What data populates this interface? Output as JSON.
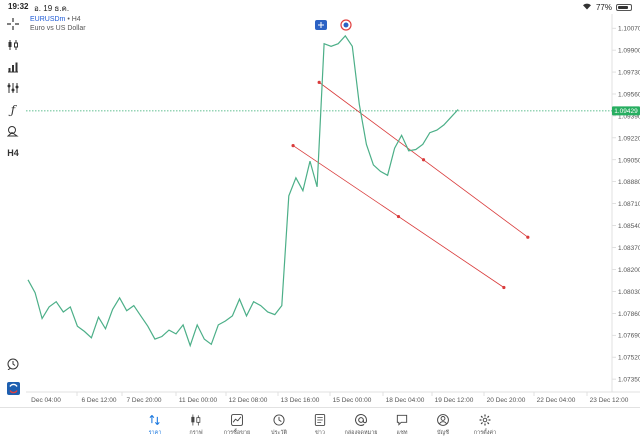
{
  "status_bar": {
    "time": "19:32",
    "date": "อ. 19 ธ.ค.",
    "battery": "77%",
    "battery_level": 0.77
  },
  "symbol": {
    "name": "EURUSDm",
    "timeframe": "H4",
    "description": "Euro vs US Dollar"
  },
  "toolbar_icons": [
    "crosshair-icon",
    "candlestick-icon",
    "chart-type-icon",
    "indicators-icon",
    "function-icon",
    "objects-icon",
    "timeframe-icon",
    "clock-icon",
    "logo-icon"
  ],
  "toolbar": {
    "timeframe_label": "H4"
  },
  "colors": {
    "line": "#4caf88",
    "bid_line": "#2eaa6e",
    "price_badge": "#27ae60",
    "trendline": "#d93b3b",
    "accent": "#1e7ae0"
  },
  "chart_data": {
    "type": "line",
    "symbol": "EURUSDm",
    "current_price": "1.09429",
    "ylim": [
      1.0725,
      1.1018
    ],
    "y_ticks": [
      "1.10070",
      "1.09900",
      "1.09730",
      "1.09560",
      "1.09390",
      "1.09220",
      "1.09050",
      "1.08880",
      "1.08710",
      "1.08540",
      "1.08370",
      "1.08200",
      "1.08030",
      "1.07860",
      "1.07690",
      "1.07520",
      "1.07350"
    ],
    "x_ticks": [
      "Dec 04:00",
      "6 Dec 12:00",
      "7 Dec 20:00",
      "11 Dec 00:00",
      "12 Dec 08:00",
      "13 Dec 16:00",
      "15 Dec 00:00",
      "18 Dec 04:00",
      "19 Dec 12:00",
      "20 Dec 20:00",
      "22 Dec 04:00",
      "23 Dec 12:00"
    ],
    "series": [
      {
        "values": [
          1.0812,
          1.0802,
          1.0782,
          1.0791,
          1.0795,
          1.0787,
          1.0791,
          1.0776,
          1.0772,
          1.0767,
          1.0783,
          1.0774,
          1.0789,
          1.0798,
          1.0788,
          1.0792,
          1.0784,
          1.0776,
          1.0766,
          1.0768,
          1.0773,
          1.077,
          1.0777,
          1.0761,
          1.0777,
          1.0766,
          1.0762,
          1.0777,
          1.078,
          1.0784,
          1.0797,
          1.0784,
          1.0795,
          1.0792,
          1.0787,
          1.0785,
          1.0792,
          1.0877,
          1.0891,
          1.0881,
          1.0904,
          1.0884,
          1.0995,
          1.0993,
          1.0995,
          1.1001,
          1.0993,
          1.0948,
          1.0917,
          1.0901,
          1.0896,
          1.0893,
          1.0914,
          1.0924,
          1.0912,
          1.0913,
          1.0917,
          1.0926,
          1.0928,
          1.0932,
          1.0938,
          1.0944
        ]
      }
    ],
    "trendlines": [
      {
        "x1": 41.3,
        "y1": 1.0965,
        "x2": 70.9,
        "y2": 1.0845
      },
      {
        "x1": 37.6,
        "y1": 1.0916,
        "x2": 67.5,
        "y2": 1.0806
      }
    ]
  },
  "bottom_nav": [
    {
      "label": "ราคา",
      "icon": "quotes-icon",
      "active": true
    },
    {
      "label": "กราฟ",
      "icon": "chart-icon",
      "active": false
    },
    {
      "label": "การซื้อขาย",
      "icon": "trade-icon",
      "active": false
    },
    {
      "label": "ประวัติ",
      "icon": "history-icon",
      "active": false
    },
    {
      "label": "ข่าว",
      "icon": "news-icon",
      "active": false
    },
    {
      "label": "กล่องจดหมาย",
      "icon": "mailbox-icon",
      "active": false
    },
    {
      "label": "แชท",
      "icon": "chat-icon",
      "active": false
    },
    {
      "label": "บัญชี",
      "icon": "account-icon",
      "active": false
    },
    {
      "label": "การตั้งค่า",
      "icon": "settings-icon",
      "active": false
    }
  ]
}
